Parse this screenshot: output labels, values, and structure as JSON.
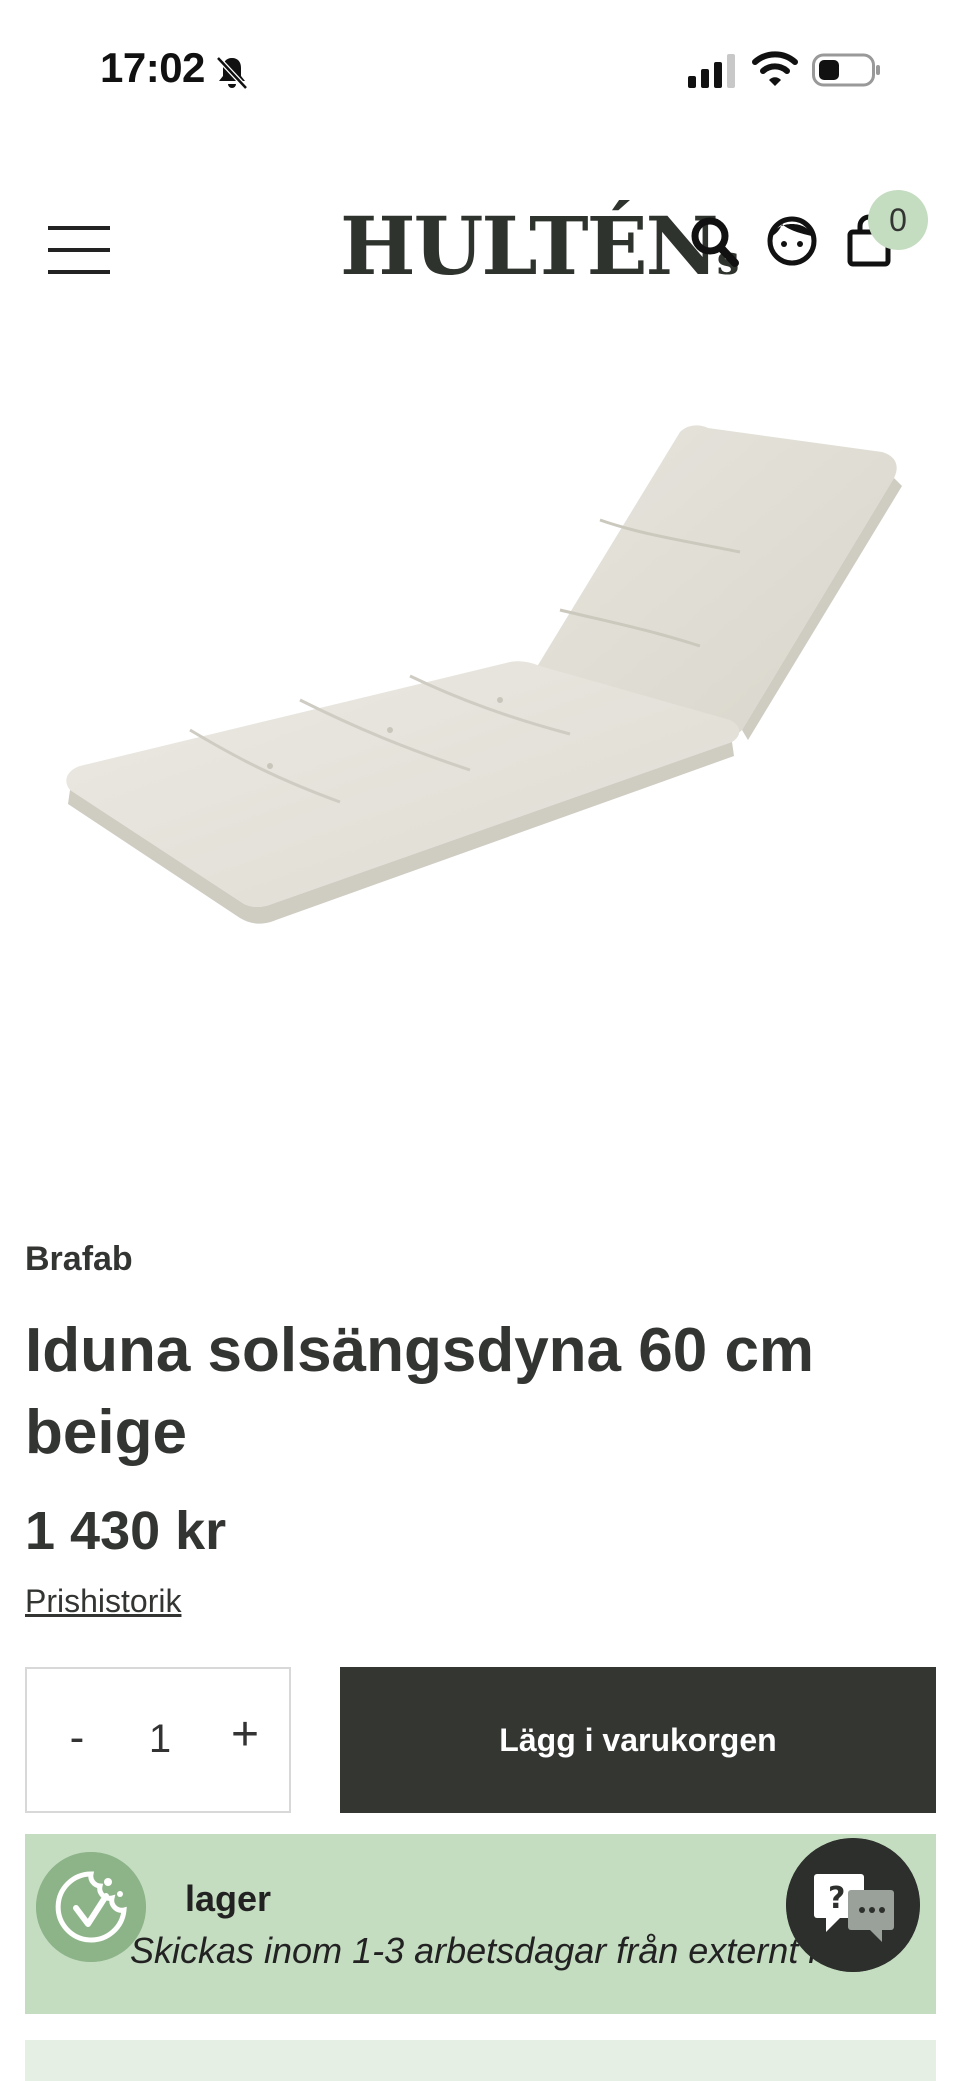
{
  "status_bar": {
    "time": "17:02"
  },
  "header": {
    "logo": "HULTÉN",
    "logo_suffix": "s",
    "cart_count": "0"
  },
  "product": {
    "brand": "Brafab",
    "title": "Iduna solsängsdyna 60 cm beige",
    "price": "1 430 kr",
    "price_history_label": "Prishistorik"
  },
  "purchase": {
    "minus_label": "-",
    "quantity": "1",
    "plus_label": "+",
    "add_to_cart_label": "Lägg i varukorgen"
  },
  "stock": {
    "title": "lager",
    "subtitle": "Skickas inom 1-3 arbetsdagar från externt l",
    "link": "L"
  },
  "colors": {
    "accent_green": "#c4dcc0",
    "dark": "#343632",
    "cushion": "#e6e3da"
  },
  "icons": [
    "bell-slash-icon",
    "signal-icon",
    "wifi-icon",
    "battery-icon",
    "menu-icon",
    "search-icon",
    "account-icon",
    "cart-icon",
    "cookie-icon",
    "chat-icon"
  ]
}
